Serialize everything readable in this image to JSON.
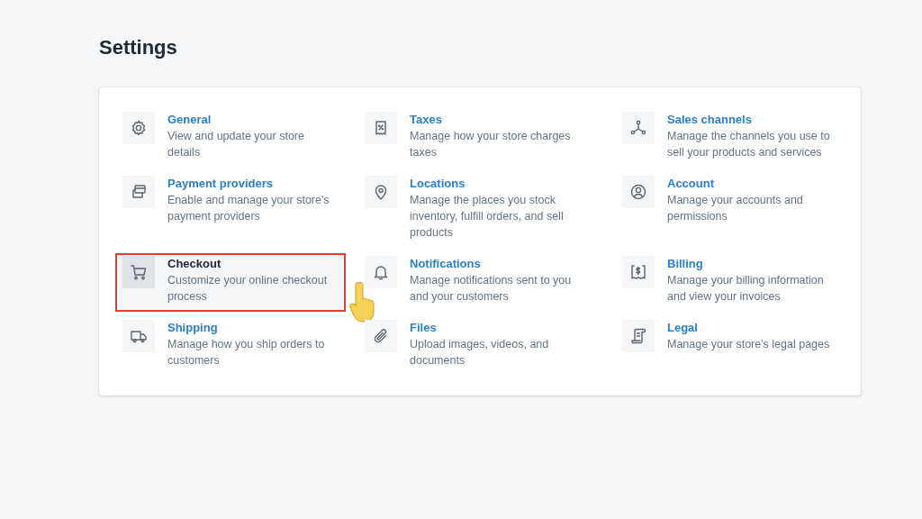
{
  "page": {
    "title": "Settings"
  },
  "items": [
    {
      "kind": "gear",
      "title": "General",
      "description": "View and update your store details",
      "selected": false
    },
    {
      "kind": "receipt-percent",
      "title": "Taxes",
      "description": "Manage how your store charges taxes",
      "selected": false
    },
    {
      "kind": "nodes",
      "title": "Sales channels",
      "description": "Manage the channels you use to sell your products and services",
      "selected": false
    },
    {
      "kind": "cards",
      "title": "Payment providers",
      "description": "Enable and manage your store's payment providers",
      "selected": false
    },
    {
      "kind": "pin",
      "title": "Locations",
      "description": "Manage the places you stock inventory, fulfill orders, and sell products",
      "selected": false
    },
    {
      "kind": "user",
      "title": "Account",
      "description": "Manage your accounts and permissions",
      "selected": false
    },
    {
      "kind": "cart",
      "title": "Checkout",
      "description": "Customize your online checkout process",
      "selected": true
    },
    {
      "kind": "bell",
      "title": "Notifications",
      "description": "Manage notifications sent to you and your customers",
      "selected": false
    },
    {
      "kind": "receipt-dollar",
      "title": "Billing",
      "description": "Manage your billing information and view your invoices",
      "selected": false
    },
    {
      "kind": "truck",
      "title": "Shipping",
      "description": "Manage how you ship orders to customers",
      "selected": false
    },
    {
      "kind": "clip",
      "title": "Files",
      "description": "Upload images, videos, and documents",
      "selected": false
    },
    {
      "kind": "scroll",
      "title": "Legal",
      "description": "Manage your store's legal pages",
      "selected": false
    }
  ]
}
